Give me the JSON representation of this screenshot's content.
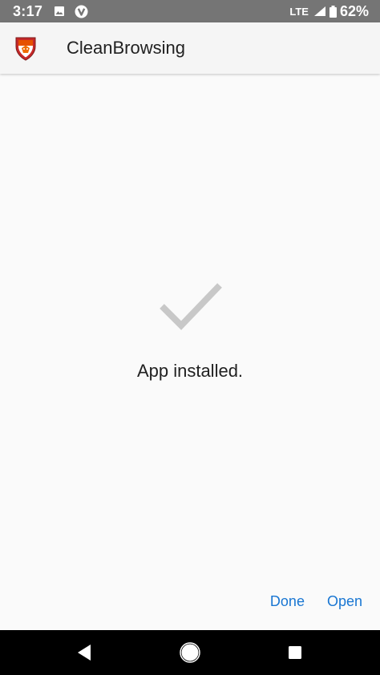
{
  "status_bar": {
    "time": "3:17",
    "network": "LTE",
    "battery": "62%",
    "notification_icons": [
      "image-icon",
      "vpn-v-icon"
    ]
  },
  "app_bar": {
    "title": "CleanBrowsing",
    "icon": "shield-logo-icon"
  },
  "main": {
    "status_icon": "checkmark-icon",
    "message": "App installed."
  },
  "actions": {
    "done_label": "Done",
    "open_label": "Open"
  },
  "navigation": {
    "back_icon": "back-triangle-icon",
    "home_icon": "home-circle-icon",
    "recents_icon": "recents-square-icon"
  },
  "colors": {
    "status_bar": "#757575",
    "app_bar": "#f5f5f5",
    "background": "#fafafa",
    "accent": "#1976d2",
    "checkmark": "#c8c8c8",
    "nav_bar": "#000000"
  }
}
